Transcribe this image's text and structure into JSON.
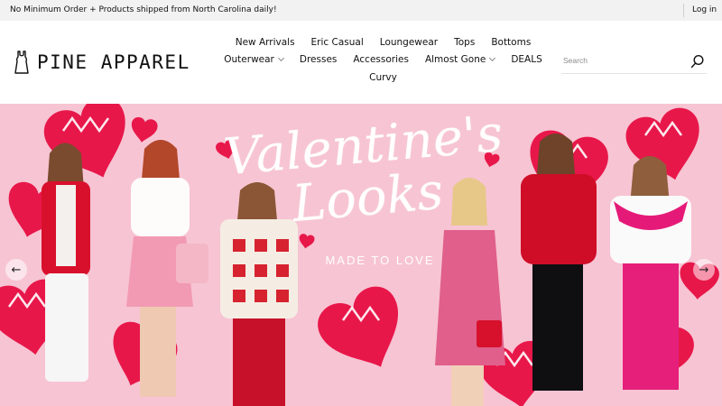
{
  "announcement": {
    "text": "No Minimum Order + Products shipped from North Carolina daily!",
    "login_label": "Log in"
  },
  "brand": {
    "name": "PINE APPAREL",
    "logo_icon": "dress-icon"
  },
  "nav": {
    "row1": [
      "New Arrivals",
      "Eric Casual",
      "Loungewear",
      "Tops",
      "Bottoms"
    ],
    "row2": [
      "Outerwear",
      "Dresses",
      "Accessories",
      "Almost Gone",
      "DEALS"
    ],
    "row3": [
      "Curvy"
    ]
  },
  "search": {
    "placeholder": "Search",
    "icon": "search-icon"
  },
  "hero": {
    "title_line1": "Valentine's",
    "title_line2": "Looks",
    "subtitle": "MADE TO LOVE",
    "prev_icon": "arrow-left-icon",
    "next_icon": "arrow-right-icon",
    "prev_glyph": "←",
    "next_glyph": "→",
    "colors": {
      "background": "#f7c4d3",
      "heart": "#e8174a",
      "accent": "#ffffff"
    }
  }
}
